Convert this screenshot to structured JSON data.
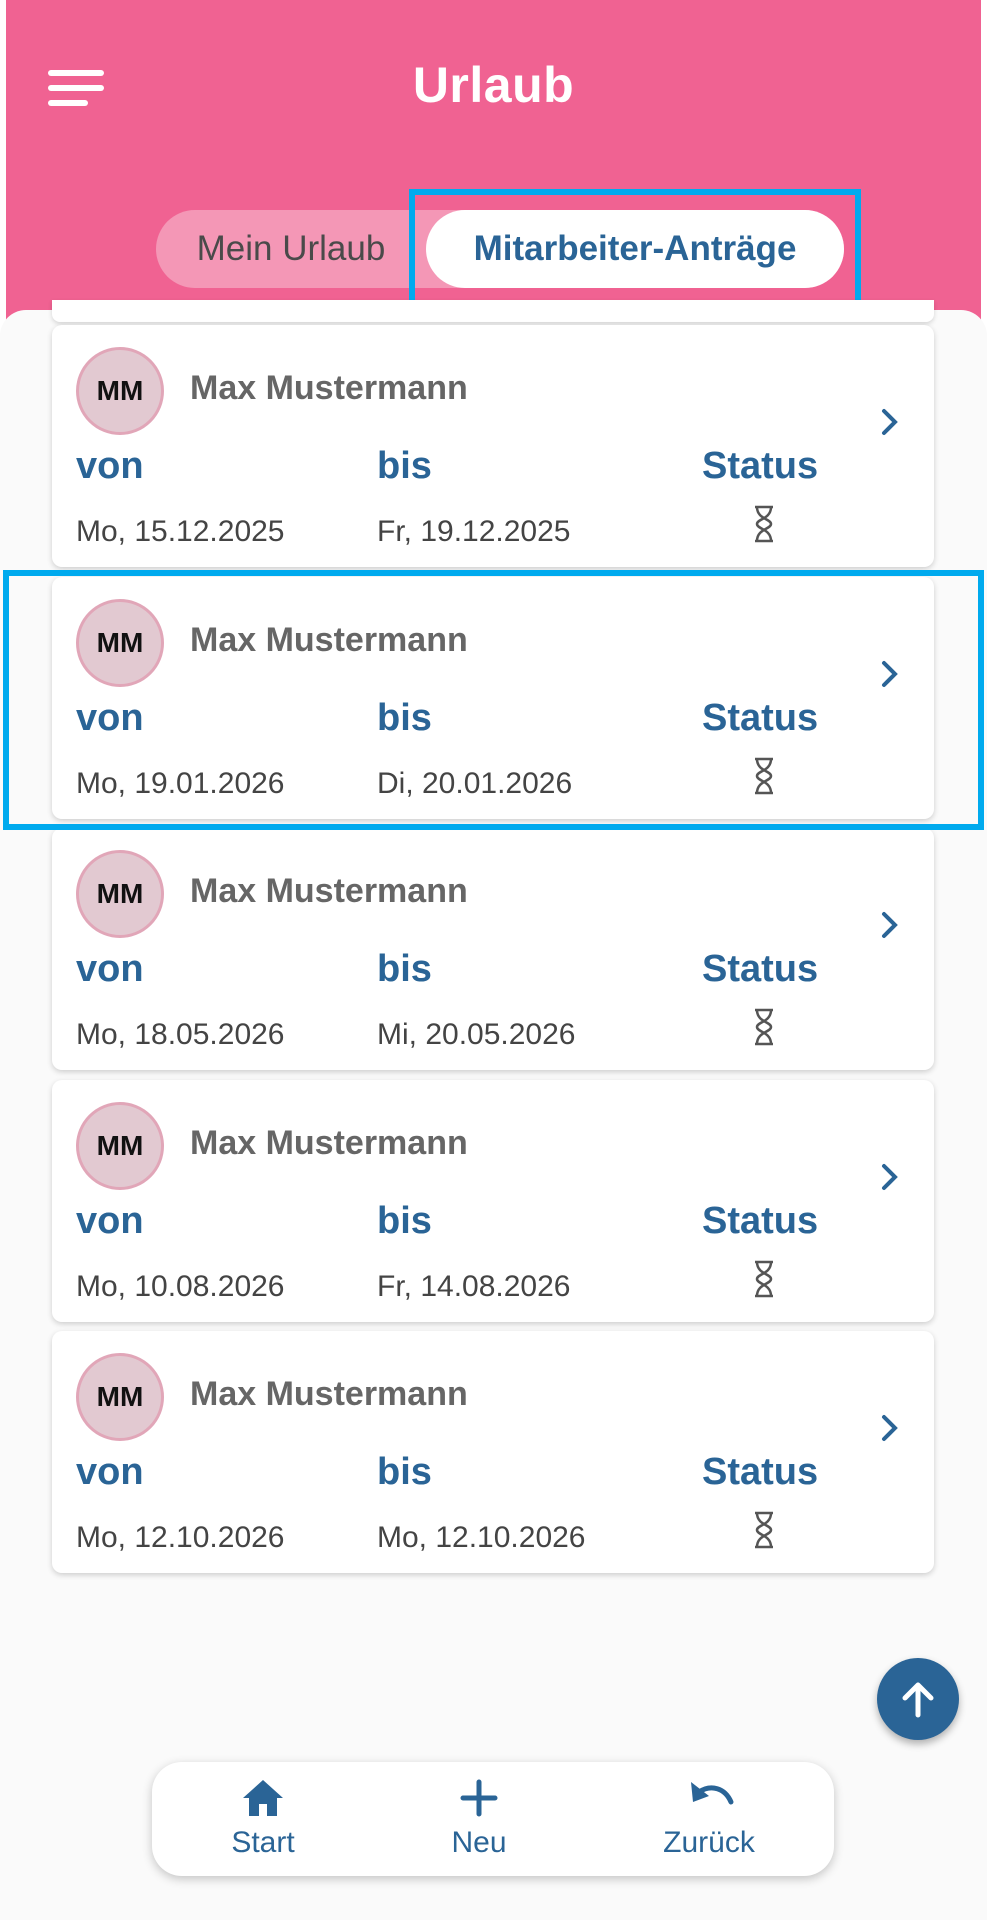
{
  "header": {
    "title": "Urlaub",
    "menu_icon": "hamburger-menu-icon",
    "tabs": [
      {
        "label": "Mein Urlaub",
        "active": false
      },
      {
        "label": "Mitarbeiter-Anträge",
        "active": true
      }
    ]
  },
  "labels": {
    "from": "von",
    "to": "bis",
    "status": "Status"
  },
  "requests": [
    {
      "initials": "MM",
      "name": "Max Mustermann",
      "from": "Mo, 15.12.2025",
      "to": "Fr, 19.12.2025",
      "status_icon": "hourglass-icon"
    },
    {
      "initials": "MM",
      "name": "Max Mustermann",
      "from": "Mo, 19.01.2026",
      "to": "Di, 20.01.2026",
      "status_icon": "hourglass-icon"
    },
    {
      "initials": "MM",
      "name": "Max Mustermann",
      "from": "Mo, 18.05.2026",
      "to": "Mi, 20.05.2026",
      "status_icon": "hourglass-icon"
    },
    {
      "initials": "MM",
      "name": "Max Mustermann",
      "from": "Mo, 10.08.2026",
      "to": "Fr, 14.08.2026",
      "status_icon": "hourglass-icon"
    },
    {
      "initials": "MM",
      "name": "Max Mustermann",
      "from": "Mo, 12.10.2026",
      "to": "Mo, 12.10.2026",
      "status_icon": "hourglass-icon"
    }
  ],
  "bottom_nav": [
    {
      "label": "Start",
      "icon": "home-icon"
    },
    {
      "label": "Neu",
      "icon": "plus-icon"
    },
    {
      "label": "Zurück",
      "icon": "undo-icon"
    }
  ],
  "colors": {
    "header": "#f06292",
    "accent": "#2a6496",
    "highlight": "#00aaee"
  }
}
